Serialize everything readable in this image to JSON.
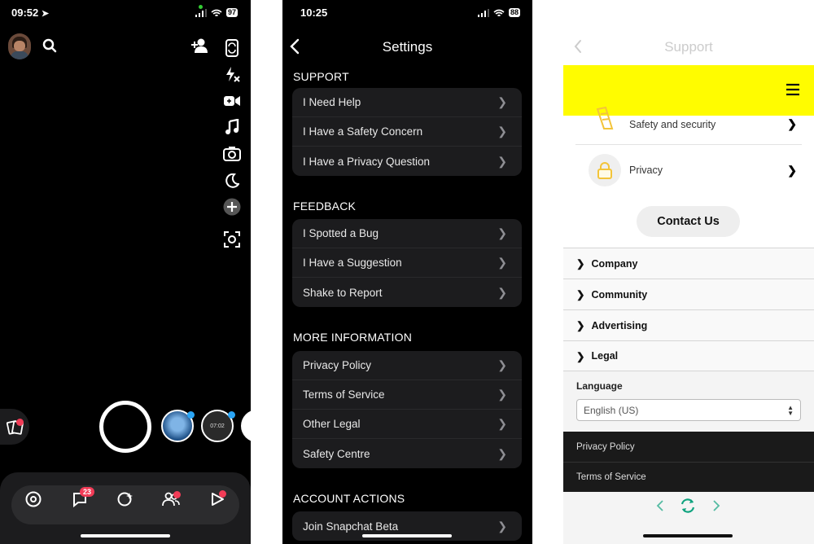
{
  "camera": {
    "time": "09:52",
    "battery": "97",
    "chat_badge": "23",
    "icons": [
      "avatar",
      "search-icon",
      "add-friend-icon",
      "flip-camera-icon",
      "flash-off-icon",
      "video-icon",
      "music-icon",
      "camera-timer-icon",
      "night-mode-icon",
      "plus-icon",
      "scan-icon",
      "memories-icon",
      "map-icon",
      "chat-icon",
      "spotlight-icon",
      "friends-icon",
      "stories-icon"
    ],
    "lens_time": "07:02"
  },
  "settings": {
    "time": "10:25",
    "battery": "88",
    "title": "Settings",
    "sections": [
      {
        "title": "SUPPORT",
        "items": [
          "I Need Help",
          "I Have a Safety Concern",
          "I Have a Privacy Question"
        ]
      },
      {
        "title": "FEEDBACK",
        "items": [
          "I Spotted a Bug",
          "I Have a Suggestion",
          "Shake to Report"
        ]
      },
      {
        "title": "MORE INFORMATION",
        "items": [
          "Privacy Policy",
          "Terms of Service",
          "Other Legal",
          "Safety Centre"
        ]
      },
      {
        "title": "ACCOUNT ACTIONS",
        "items": [
          "Join Snapchat Beta"
        ]
      }
    ]
  },
  "support": {
    "title": "Support",
    "topics": [
      "Safety and security",
      "Privacy"
    ],
    "contact": "Contact Us",
    "accordion": [
      "Company",
      "Community",
      "Advertising",
      "Legal"
    ],
    "language_label": "Language",
    "language_value": "English (US)",
    "footer_links": [
      "Privacy Policy",
      "Terms of Service"
    ],
    "brand_color": "#fffc00",
    "accent_color": "#10a37f"
  }
}
